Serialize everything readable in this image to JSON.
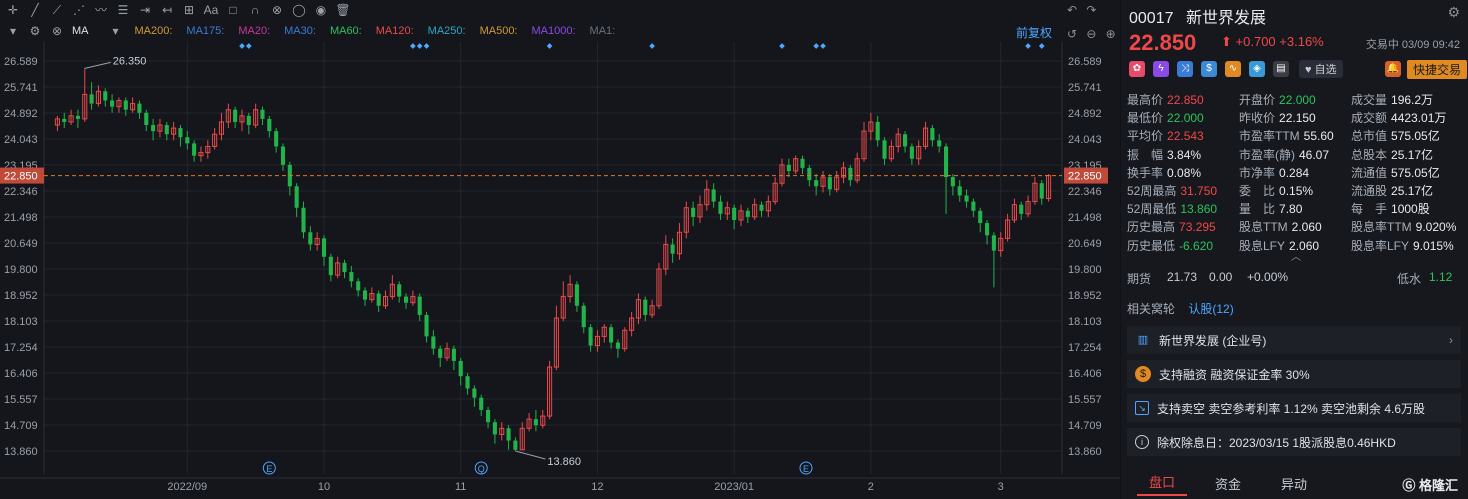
{
  "toolbar": {
    "ma_label": "MA",
    "adjust_label": "前复权",
    "ma_items": [
      {
        "label": "MA200:",
        "color": "#d19a33"
      },
      {
        "label": "MA175:",
        "color": "#3a7bd5"
      },
      {
        "label": "MA20:",
        "color": "#c8379a"
      },
      {
        "label": "MA30:",
        "color": "#3a7bd5"
      },
      {
        "label": "MA60:",
        "color": "#2bc35a"
      },
      {
        "label": "MA120:",
        "color": "#e84a4a"
      },
      {
        "label": "MA250:",
        "color": "#29a8c8"
      },
      {
        "label": "MA500:",
        "color": "#d19a33"
      },
      {
        "label": "MA1000:",
        "color": "#8a4ae8"
      },
      {
        "label": "MA1:",
        "color": "#6a707a"
      }
    ]
  },
  "chart_data": {
    "type": "candlestick",
    "y_ticks": [
      "26.589",
      "25.741",
      "24.892",
      "24.043",
      "23.195",
      "22.346",
      "21.498",
      "20.649",
      "19.800",
      "18.952",
      "18.103",
      "17.254",
      "16.406",
      "15.557",
      "14.709",
      "13.860"
    ],
    "ylim": [
      13.435,
      27.014
    ],
    "x_ticks": [
      "2022/09",
      "10",
      "11",
      "12",
      "2023/01",
      "2",
      "3"
    ],
    "current_price_label": "22.850",
    "annotations": {
      "high": "26.350",
      "low": "13.860"
    },
    "markers": [
      "E",
      "Q",
      "E"
    ],
    "up_color": "#e84a4a",
    "down_color": "#22b34a",
    "candles": [
      [
        24.5,
        24.7,
        24.3,
        24.8
      ],
      [
        24.7,
        24.6,
        24.4,
        24.9
      ],
      [
        24.6,
        24.8,
        24.5,
        25.0
      ],
      [
        24.8,
        24.7,
        24.4,
        25.0
      ],
      [
        24.7,
        25.5,
        24.6,
        26.35
      ],
      [
        25.5,
        25.2,
        25.0,
        25.9
      ],
      [
        25.2,
        25.6,
        25.1,
        25.8
      ],
      [
        25.6,
        25.3,
        25.1,
        25.7
      ],
      [
        25.3,
        25.1,
        24.9,
        25.5
      ],
      [
        25.1,
        25.3,
        24.9,
        25.4
      ],
      [
        25.3,
        25.0,
        24.8,
        25.4
      ],
      [
        25.0,
        25.2,
        24.9,
        25.4
      ],
      [
        25.2,
        24.9,
        24.7,
        25.3
      ],
      [
        24.9,
        24.5,
        24.3,
        25.0
      ],
      [
        24.5,
        24.3,
        24.0,
        24.7
      ],
      [
        24.3,
        24.5,
        24.1,
        24.7
      ],
      [
        24.5,
        24.2,
        24.0,
        24.6
      ],
      [
        24.2,
        24.4,
        24.0,
        24.6
      ],
      [
        24.4,
        24.1,
        23.8,
        24.5
      ],
      [
        24.1,
        23.9,
        23.7,
        24.3
      ],
      [
        23.9,
        23.5,
        23.3,
        24.0
      ],
      [
        23.5,
        23.6,
        23.3,
        23.8
      ],
      [
        23.6,
        23.8,
        23.4,
        24.0
      ],
      [
        23.8,
        24.2,
        23.7,
        24.4
      ],
      [
        24.2,
        24.6,
        24.0,
        24.9
      ],
      [
        24.6,
        25.0,
        24.4,
        25.2
      ],
      [
        25.0,
        24.6,
        24.4,
        25.1
      ],
      [
        24.6,
        24.8,
        24.3,
        25.0
      ],
      [
        24.8,
        24.5,
        24.2,
        24.9
      ],
      [
        24.5,
        25.0,
        24.4,
        25.2
      ],
      [
        25.0,
        24.7,
        24.5,
        25.1
      ],
      [
        24.7,
        24.3,
        24.1,
        24.8
      ],
      [
        24.3,
        23.8,
        23.6,
        24.4
      ],
      [
        23.8,
        23.2,
        23.0,
        23.9
      ],
      [
        23.2,
        22.5,
        22.2,
        23.3
      ],
      [
        22.5,
        21.8,
        21.5,
        22.6
      ],
      [
        21.8,
        21.0,
        20.8,
        22.0
      ],
      [
        21.0,
        20.6,
        20.4,
        21.2
      ],
      [
        20.6,
        20.8,
        20.4,
        21.0
      ],
      [
        20.8,
        20.2,
        19.9,
        20.9
      ],
      [
        20.2,
        19.6,
        19.4,
        20.3
      ],
      [
        19.6,
        20.0,
        19.5,
        20.2
      ],
      [
        20.0,
        19.7,
        19.5,
        20.1
      ],
      [
        19.7,
        19.4,
        19.2,
        19.9
      ],
      [
        19.4,
        19.1,
        18.9,
        19.5
      ],
      [
        19.1,
        18.8,
        18.6,
        19.2
      ],
      [
        18.8,
        19.0,
        18.7,
        19.2
      ],
      [
        19.0,
        18.6,
        18.4,
        19.1
      ],
      [
        18.6,
        18.9,
        18.5,
        19.1
      ],
      [
        18.9,
        19.3,
        18.8,
        19.6
      ],
      [
        19.3,
        18.9,
        18.7,
        19.4
      ],
      [
        18.9,
        18.7,
        18.5,
        19.0
      ],
      [
        18.7,
        18.9,
        18.6,
        19.1
      ],
      [
        18.9,
        18.3,
        18.1,
        19.0
      ],
      [
        18.3,
        17.6,
        17.4,
        18.4
      ],
      [
        17.6,
        17.2,
        17.0,
        17.8
      ],
      [
        17.2,
        16.9,
        16.6,
        17.3
      ],
      [
        16.9,
        17.2,
        16.8,
        17.4
      ],
      [
        17.2,
        16.8,
        16.5,
        17.3
      ],
      [
        16.8,
        16.3,
        16.0,
        16.9
      ],
      [
        16.3,
        15.9,
        15.7,
        16.4
      ],
      [
        15.9,
        15.6,
        15.3,
        16.0
      ],
      [
        15.6,
        15.2,
        15.0,
        15.7
      ],
      [
        15.2,
        14.8,
        14.6,
        15.3
      ],
      [
        14.8,
        14.4,
        14.1,
        14.9
      ],
      [
        14.4,
        14.6,
        14.2,
        14.8
      ],
      [
        14.6,
        14.2,
        13.9,
        14.7
      ],
      [
        14.2,
        13.9,
        13.86,
        14.3
      ],
      [
        13.9,
        14.6,
        13.9,
        14.8
      ],
      [
        14.6,
        14.9,
        14.5,
        15.1
      ],
      [
        14.9,
        14.7,
        14.5,
        15.2
      ],
      [
        14.7,
        15.0,
        14.6,
        15.2
      ],
      [
        15.0,
        16.6,
        14.9,
        16.8
      ],
      [
        16.6,
        18.2,
        16.5,
        18.6
      ],
      [
        18.2,
        18.9,
        18.1,
        19.4
      ],
      [
        18.9,
        19.3,
        18.7,
        19.6
      ],
      [
        19.3,
        18.6,
        18.4,
        19.4
      ],
      [
        18.6,
        17.9,
        17.7,
        18.7
      ],
      [
        17.9,
        17.3,
        17.1,
        18.0
      ],
      [
        17.3,
        17.6,
        17.1,
        17.8
      ],
      [
        17.6,
        17.9,
        17.4,
        18.0
      ],
      [
        17.9,
        17.4,
        17.2,
        18.0
      ],
      [
        17.4,
        17.2,
        16.9,
        17.5
      ],
      [
        17.2,
        17.8,
        17.1,
        17.9
      ],
      [
        17.8,
        18.2,
        17.6,
        18.4
      ],
      [
        18.2,
        18.8,
        18.0,
        19.0
      ],
      [
        18.8,
        18.3,
        18.1,
        18.9
      ],
      [
        18.3,
        18.6,
        18.2,
        18.8
      ],
      [
        18.6,
        19.8,
        18.5,
        20.0
      ],
      [
        19.8,
        20.6,
        19.6,
        20.9
      ],
      [
        20.6,
        20.3,
        20.0,
        20.8
      ],
      [
        20.3,
        21.0,
        20.1,
        21.3
      ],
      [
        21.0,
        21.8,
        20.8,
        22.0
      ],
      [
        21.8,
        21.5,
        21.2,
        22.0
      ],
      [
        21.5,
        21.9,
        21.3,
        22.2
      ],
      [
        21.9,
        22.4,
        21.7,
        22.7
      ],
      [
        22.4,
        22.0,
        21.8,
        22.6
      ],
      [
        22.0,
        21.6,
        21.4,
        22.2
      ],
      [
        21.6,
        21.8,
        21.4,
        22.0
      ],
      [
        21.8,
        21.4,
        21.1,
        21.9
      ],
      [
        21.4,
        21.7,
        21.2,
        21.9
      ],
      [
        21.7,
        21.5,
        21.3,
        21.8
      ],
      [
        21.5,
        21.9,
        21.4,
        22.1
      ],
      [
        21.9,
        21.7,
        21.5,
        22.0
      ],
      [
        21.7,
        22.0,
        21.5,
        22.2
      ],
      [
        22.0,
        22.6,
        21.9,
        22.8
      ],
      [
        22.6,
        23.2,
        22.5,
        23.4
      ],
      [
        23.2,
        23.0,
        22.8,
        23.4
      ],
      [
        23.0,
        23.4,
        22.9,
        23.5
      ],
      [
        23.4,
        23.1,
        22.9,
        23.5
      ],
      [
        23.1,
        22.7,
        22.5,
        23.2
      ],
      [
        22.7,
        22.5,
        22.2,
        22.9
      ],
      [
        22.5,
        22.8,
        22.3,
        23.0
      ],
      [
        22.8,
        22.4,
        22.2,
        22.9
      ],
      [
        22.4,
        22.8,
        22.3,
        23.0
      ],
      [
        22.8,
        23.1,
        22.6,
        23.3
      ],
      [
        23.1,
        22.7,
        22.5,
        23.2
      ],
      [
        22.7,
        23.4,
        22.6,
        23.6
      ],
      [
        23.4,
        24.3,
        23.3,
        24.6
      ],
      [
        24.3,
        24.6,
        24.0,
        24.9
      ],
      [
        24.6,
        24.0,
        23.8,
        24.8
      ],
      [
        24.0,
        23.4,
        23.2,
        24.1
      ],
      [
        23.4,
        23.8,
        23.3,
        24.0
      ],
      [
        23.8,
        24.2,
        23.6,
        24.4
      ],
      [
        24.2,
        23.8,
        23.6,
        24.3
      ],
      [
        23.8,
        23.4,
        23.2,
        23.9
      ],
      [
        23.4,
        23.8,
        23.2,
        24.0
      ],
      [
        23.8,
        24.4,
        23.7,
        24.6
      ],
      [
        24.4,
        24.0,
        23.8,
        24.5
      ],
      [
        24.0,
        23.8,
        23.6,
        24.2
      ],
      [
        23.8,
        22.8,
        21.6,
        23.9
      ],
      [
        22.8,
        22.5,
        22.2,
        22.9
      ],
      [
        22.5,
        22.2,
        22.0,
        22.7
      ],
      [
        22.2,
        22.0,
        21.8,
        22.4
      ],
      [
        22.0,
        21.7,
        21.5,
        22.1
      ],
      [
        21.7,
        21.3,
        21.0,
        21.8
      ],
      [
        21.3,
        20.9,
        20.6,
        21.4
      ],
      [
        20.9,
        20.4,
        19.2,
        21.0
      ],
      [
        20.4,
        20.8,
        20.2,
        21.0
      ],
      [
        20.8,
        21.4,
        20.7,
        21.6
      ],
      [
        21.4,
        21.9,
        21.3,
        22.1
      ],
      [
        21.9,
        21.6,
        21.4,
        22.0
      ],
      [
        21.6,
        22.0,
        21.5,
        22.2
      ],
      [
        22.0,
        22.6,
        21.9,
        22.8
      ],
      [
        22.6,
        22.1,
        21.9,
        22.7
      ],
      [
        22.1,
        22.85,
        22.0,
        22.9
      ]
    ]
  },
  "quote": {
    "code": "00017",
    "name": "新世界发展",
    "price": "22.850",
    "arrow": "⬆",
    "change": "+0.700",
    "change_pct": "+3.16%",
    "status": "交易中 03/09 09:42",
    "fav_label": "自选",
    "fast_trade_label": "快捷交易",
    "stats": [
      [
        {
          "l": "最高价",
          "v": "22.850",
          "c": "up"
        },
        {
          "l": "开盘价",
          "v": "22.000",
          "c": "down"
        },
        {
          "l": "成交量",
          "v": "196.2万",
          "c": "neu"
        }
      ],
      [
        {
          "l": "最低价",
          "v": "22.000",
          "c": "down"
        },
        {
          "l": "昨收价",
          "v": "22.150",
          "c": "neu"
        },
        {
          "l": "成交额",
          "v": "4423.01万",
          "c": "neu"
        }
      ],
      [
        {
          "l": "平均价",
          "v": "22.543",
          "c": "up"
        },
        {
          "l": "市盈率TTM",
          "v": "55.60",
          "c": "neu"
        },
        {
          "l": "总市值",
          "v": "575.05亿",
          "c": "neu"
        }
      ],
      [
        {
          "l": "振　幅",
          "v": "3.84%",
          "c": "neu"
        },
        {
          "l": "市盈率(静)",
          "v": "46.07",
          "c": "neu"
        },
        {
          "l": "总股本",
          "v": "25.17亿",
          "c": "neu"
        }
      ],
      [
        {
          "l": "换手率",
          "v": "0.08%",
          "c": "neu"
        },
        {
          "l": "市净率",
          "v": "0.284",
          "c": "neu"
        },
        {
          "l": "流通值",
          "v": "575.05亿",
          "c": "neu"
        }
      ],
      [
        {
          "l": "52周最高",
          "v": "31.750",
          "c": "up"
        },
        {
          "l": "委　比",
          "v": "0.15%",
          "c": "neu"
        },
        {
          "l": "流通股",
          "v": "25.17亿",
          "c": "neu"
        }
      ],
      [
        {
          "l": "52周最低",
          "v": "13.860",
          "c": "down"
        },
        {
          "l": "量　比",
          "v": "7.80",
          "c": "neu"
        },
        {
          "l": "每　手",
          "v": "1000股",
          "c": "neu"
        }
      ],
      [
        {
          "l": "历史最高",
          "v": "73.295",
          "c": "up"
        },
        {
          "l": "股息TTM",
          "v": "2.060",
          "c": "neu"
        },
        {
          "l": "股息率TTM",
          "v": "9.020%",
          "c": "neu"
        }
      ],
      [
        {
          "l": "历史最低",
          "v": "-6.620",
          "c": "down"
        },
        {
          "l": "股息LFY",
          "v": "2.060",
          "c": "neu"
        },
        {
          "l": "股息率LFY",
          "v": "9.015%",
          "c": "neu"
        }
      ]
    ],
    "futures": {
      "label": "期货",
      "price": "21.73",
      "chg": "0.00",
      "pct": "+0.00%",
      "water_label": "低水",
      "water_val": "1.12"
    },
    "related": {
      "title": "相关窝轮",
      "tab": "认股(12)"
    },
    "cards": [
      {
        "text": "新世界发展 (企业号)"
      },
      {
        "text": "支持融资 融资保证金率 30%"
      },
      {
        "text": "支持卖空 卖空参考利率 1.12% 卖空池剩余 4.6万股"
      },
      {
        "text": "除权除息日：2023/03/15  1股派股息0.46HKD"
      }
    ],
    "tabs": [
      "盘口",
      "资金",
      "异动"
    ],
    "logo": "格隆汇"
  }
}
